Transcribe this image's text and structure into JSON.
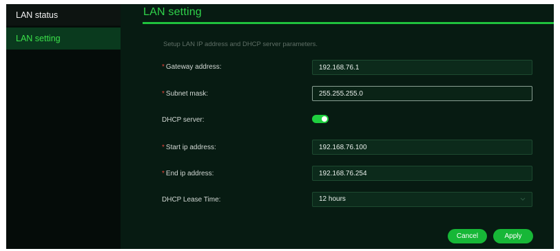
{
  "sidebar": {
    "items": [
      {
        "label": "LAN status",
        "active": false
      },
      {
        "label": "LAN setting",
        "active": true
      }
    ]
  },
  "main": {
    "title": "LAN setting",
    "description": "Setup LAN IP address and DHCP server parameters.",
    "fields": {
      "gateway": {
        "required_mark": "*",
        "label": "Gateway address:",
        "value": "192.168.76.1"
      },
      "subnet": {
        "required_mark": "*",
        "label": "Subnet mask:",
        "value": "255.255.255.0"
      },
      "dhcp_server": {
        "label": "DHCP server:",
        "enabled": true
      },
      "start_ip": {
        "required_mark": "*",
        "label": "Start ip address:",
        "value": "192.168.76.100"
      },
      "end_ip": {
        "required_mark": "*",
        "label": "End ip address:",
        "value": "192.168.76.254"
      },
      "lease_time": {
        "label": "DHCP Lease Time:",
        "value": "12 hours",
        "icon": "chevron-down-icon"
      }
    },
    "buttons": {
      "cancel": "Cancel",
      "apply": "Apply"
    }
  },
  "colors": {
    "accent": "#1fc23d",
    "active_text": "#3be04a",
    "background": "#071b12",
    "sidebar_bg": "#050c09",
    "required": "#e0463c"
  }
}
